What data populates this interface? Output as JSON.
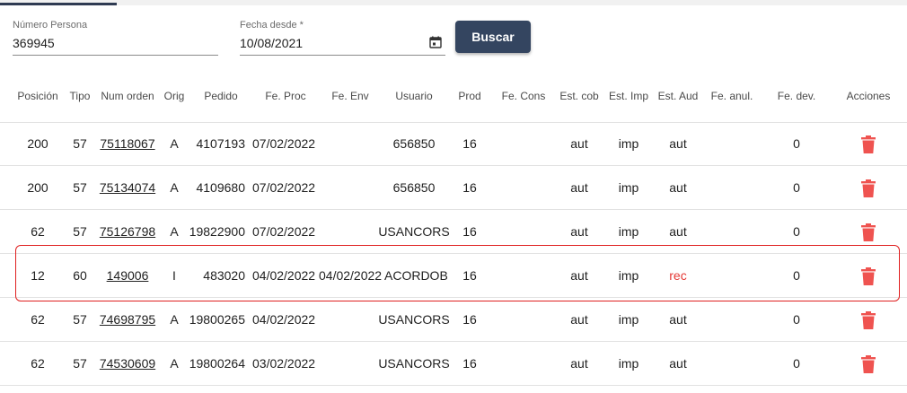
{
  "search": {
    "persona_label": "Número Persona",
    "persona_value": "369945",
    "fecha_label": "Fecha desde *",
    "fecha_value": "10/08/2021",
    "button_label": "Buscar"
  },
  "table": {
    "headers": [
      "Posición",
      "Tipo",
      "Num orden",
      "Orig",
      "Pedido",
      "Fe. Proc",
      "Fe. Env",
      "Usuario",
      "Prod",
      "Fe. Cons",
      "Est. cob",
      "Est. Imp",
      "Est. Aud",
      "Fe. anul.",
      "Fe. dev.",
      "Acciones"
    ],
    "rows": [
      {
        "posicion": "200",
        "tipo": "57",
        "num_orden": "75118067",
        "orig": "A",
        "pedido": "4107193",
        "fe_proc": "07/02/2022",
        "fe_env": "",
        "usuario": "656850",
        "prod": "16",
        "fe_cons": "",
        "est_cob": "aut",
        "est_imp": "imp",
        "est_aud": "aut",
        "fe_anul": "",
        "fe_dev": "0"
      },
      {
        "posicion": "200",
        "tipo": "57",
        "num_orden": "75134074",
        "orig": "A",
        "pedido": "4109680",
        "fe_proc": "07/02/2022",
        "fe_env": "",
        "usuario": "656850",
        "prod": "16",
        "fe_cons": "",
        "est_cob": "aut",
        "est_imp": "imp",
        "est_aud": "aut",
        "fe_anul": "",
        "fe_dev": "0"
      },
      {
        "posicion": "62",
        "tipo": "57",
        "num_orden": "75126798",
        "orig": "A",
        "pedido": "19822900",
        "fe_proc": "07/02/2022",
        "fe_env": "",
        "usuario": "USANCORS",
        "prod": "16",
        "fe_cons": "",
        "est_cob": "aut",
        "est_imp": "imp",
        "est_aud": "aut",
        "fe_anul": "",
        "fe_dev": "0"
      },
      {
        "posicion": "12",
        "tipo": "60",
        "num_orden": "149006",
        "orig": "I",
        "pedido": "483020",
        "fe_proc": "04/02/2022",
        "fe_env": "04/02/2022",
        "usuario": "ACORDOBA",
        "prod": "16",
        "fe_cons": "",
        "est_cob": "aut",
        "est_imp": "imp",
        "est_aud": "rec",
        "fe_anul": "",
        "fe_dev": "0"
      },
      {
        "posicion": "62",
        "tipo": "57",
        "num_orden": "74698795",
        "orig": "A",
        "pedido": "19800265",
        "fe_proc": "04/02/2022",
        "fe_env": "",
        "usuario": "USANCORS",
        "prod": "16",
        "fe_cons": "",
        "est_cob": "aut",
        "est_imp": "imp",
        "est_aud": "aut",
        "fe_anul": "",
        "fe_dev": "0"
      },
      {
        "posicion": "62",
        "tipo": "57",
        "num_orden": "74530609",
        "orig": "A",
        "pedido": "19800264",
        "fe_proc": "03/02/2022",
        "fe_env": "",
        "usuario": "USANCORS",
        "prod": "16",
        "fe_cons": "",
        "est_cob": "aut",
        "est_imp": "imp",
        "est_aud": "aut",
        "fe_anul": "",
        "fe_dev": "0"
      }
    ]
  },
  "icons": {
    "delete": "trash-icon",
    "calendar": "calendar-icon"
  },
  "colors": {
    "button": "#344560",
    "delete": "#ef5350",
    "rec": "#e53935",
    "highlight": "#e02020"
  }
}
